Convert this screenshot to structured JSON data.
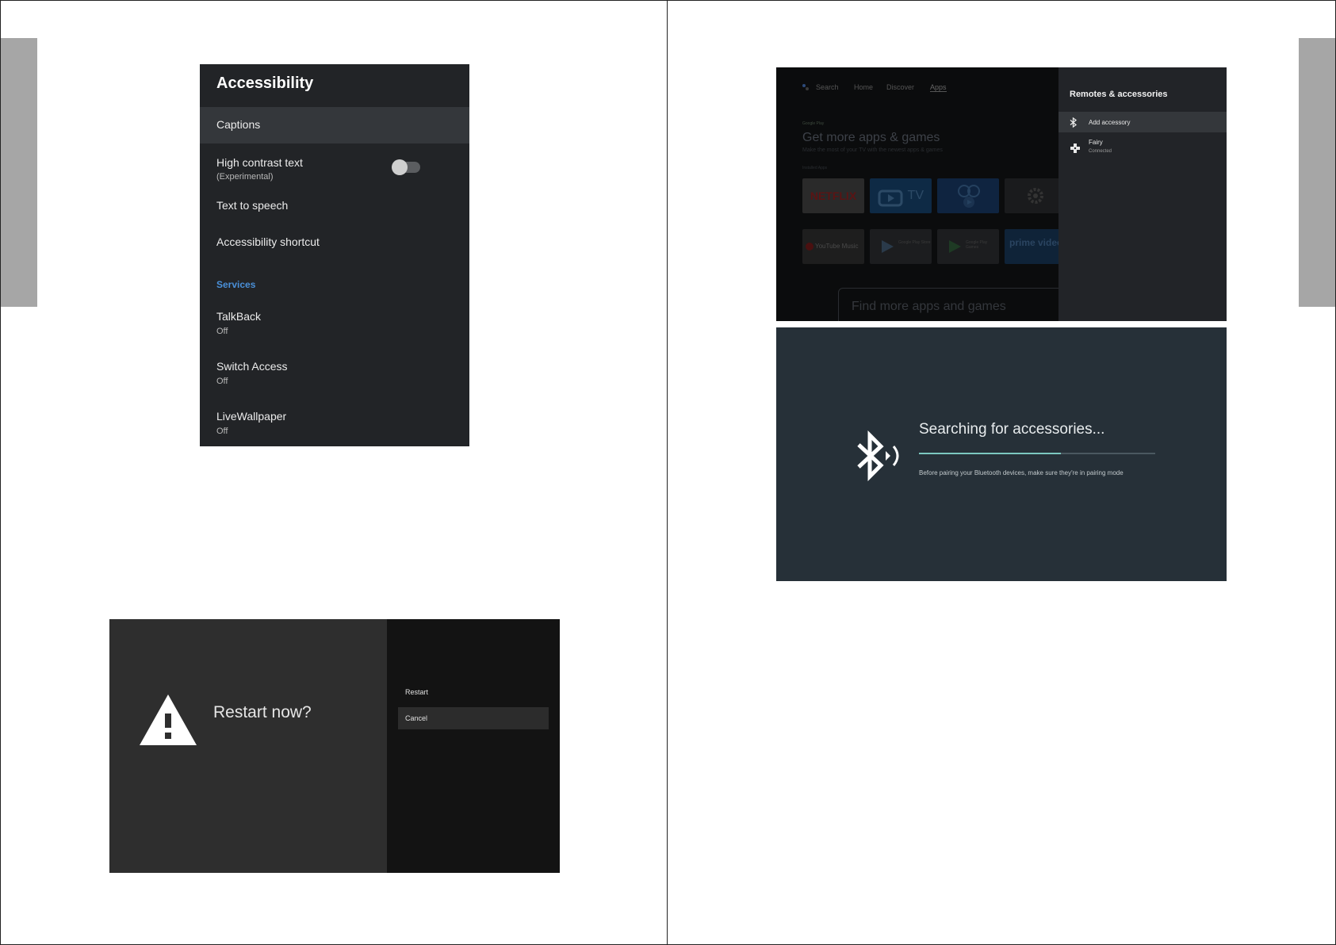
{
  "accessibility": {
    "title": "Accessibility",
    "captions": "Captions",
    "high_contrast": {
      "label": "High contrast text",
      "sub": "(Experimental)",
      "enabled": false
    },
    "tts": "Text to speech",
    "shortcut": "Accessibility shortcut",
    "services_header": "Services",
    "services": [
      {
        "label": "TalkBack",
        "status": "Off"
      },
      {
        "label": "Switch Access",
        "status": "Off"
      },
      {
        "label": "LiveWallpaper",
        "status": "Off"
      }
    ]
  },
  "restart": {
    "title": "Restart now?",
    "options": [
      "Restart",
      "Cancel"
    ],
    "selected": "Cancel"
  },
  "home": {
    "nav": [
      "Search",
      "Home",
      "Discover",
      "Apps"
    ],
    "google_play": "Google Play",
    "headline": "Get more apps & games",
    "desc": "Make the most of your TV with the newest apps & games",
    "section": "Installed Apps",
    "apps": [
      "NETFLIX",
      "TV",
      "",
      "",
      "YouTube Music",
      "Google Play Store",
      "Google Play Games",
      "prime video"
    ],
    "find": "Find more apps and games"
  },
  "remotes": {
    "title": "Remotes & accessories",
    "items": [
      {
        "label": "Add accessory",
        "icon": "bluetooth-icon"
      },
      {
        "label": "Fairy",
        "status": "Connected",
        "icon": "gamepad-icon"
      }
    ]
  },
  "searching": {
    "title": "Searching for accessories...",
    "hint": "Before pairing your Bluetooth devices, make sure they're in pairing mode",
    "progress": 0.6,
    "colors": {
      "track": "#4a5860",
      "fill": "#7cc7c0"
    }
  }
}
